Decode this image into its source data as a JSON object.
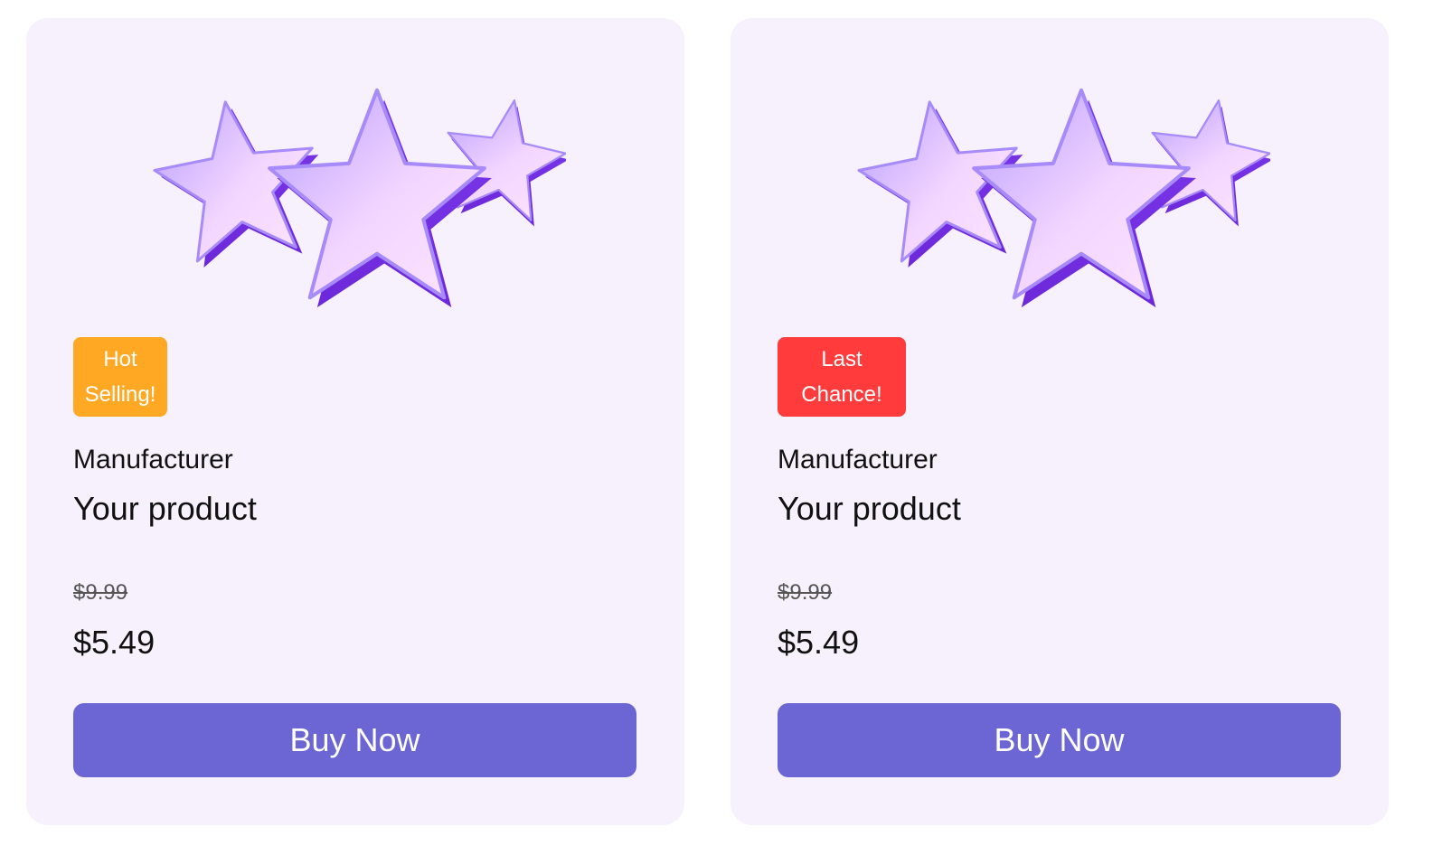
{
  "products": [
    {
      "badge": {
        "line1": "Hot",
        "line2": "Selling!",
        "color": "#ffa824"
      },
      "manufacturer": "Manufacturer",
      "name": "Your product",
      "old_price": "$9.99",
      "price": "$5.49",
      "button_label": "Buy Now"
    },
    {
      "badge": {
        "line1": "Last",
        "line2": "Chance!",
        "color": "#ff3b3b"
      },
      "manufacturer": "Manufacturer",
      "name": "Your product",
      "old_price": "$9.99",
      "price": "$5.49",
      "button_label": "Buy Now"
    }
  ],
  "colors": {
    "card_bg": "#f6f1fd",
    "button_bg": "#6b66d4",
    "star_purple": "#8b5cf6"
  },
  "image_icon": "three-stars-icon"
}
